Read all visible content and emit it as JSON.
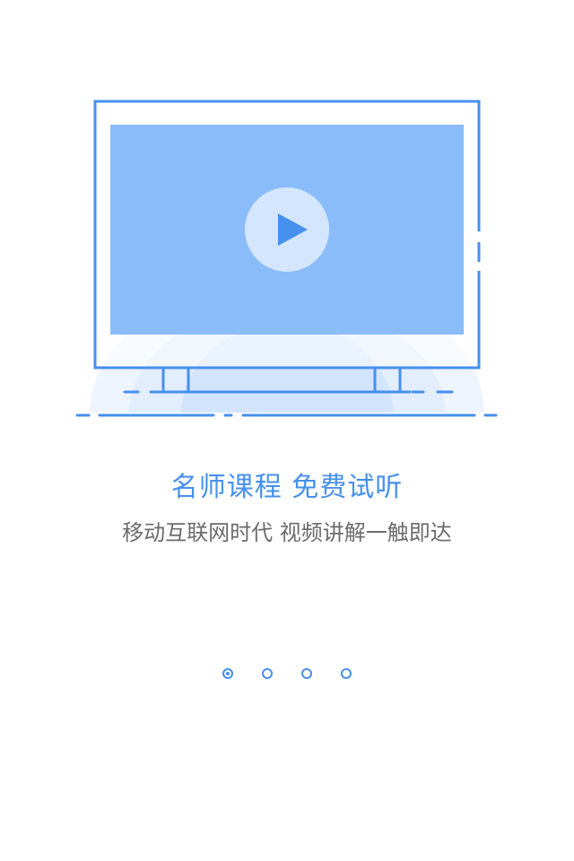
{
  "intro": {
    "title": "名师课程 免费试听",
    "subtitle": "移动互联网时代 视频讲解一触即达"
  },
  "pager": {
    "total": 4,
    "active_index": 0
  },
  "icons": {
    "hero": "video-screen-illustration",
    "play": "play-icon"
  },
  "colors": {
    "accent": "#4690ee",
    "screen_fill": "#8bbcfa",
    "title_text": "#4690ee",
    "subtitle_text": "#6b6b6b"
  }
}
